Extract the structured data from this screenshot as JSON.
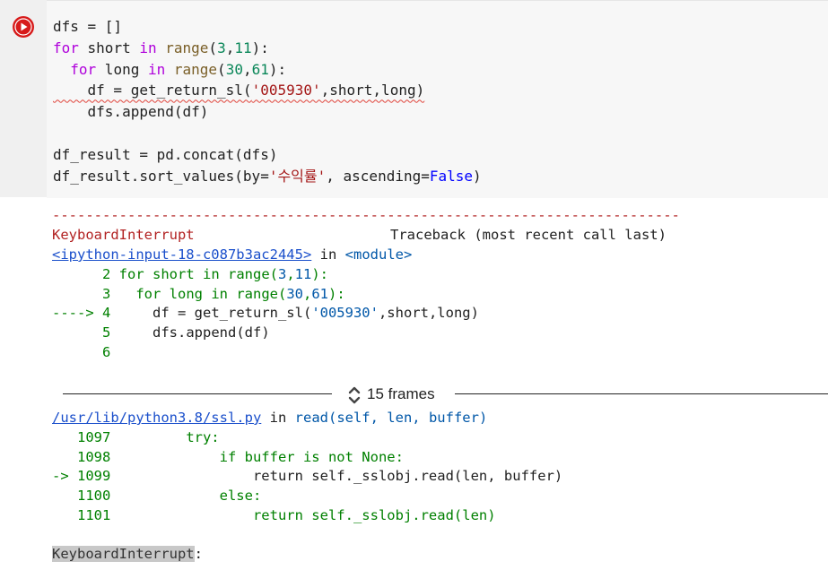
{
  "cell": {
    "code_lines": [
      {
        "parts": [
          {
            "t": "dfs = []",
            "c": ""
          }
        ]
      },
      {
        "parts": [
          {
            "t": "for",
            "c": "kw"
          },
          {
            "t": " short ",
            "c": ""
          },
          {
            "t": "in",
            "c": "kw"
          },
          {
            "t": " ",
            "c": ""
          },
          {
            "t": "range",
            "c": "bi"
          },
          {
            "t": "(",
            "c": ""
          },
          {
            "t": "3",
            "c": "num"
          },
          {
            "t": ",",
            "c": ""
          },
          {
            "t": "11",
            "c": "num"
          },
          {
            "t": "):",
            "c": ""
          }
        ]
      },
      {
        "parts": [
          {
            "t": "  ",
            "c": ""
          },
          {
            "t": "for",
            "c": "kw"
          },
          {
            "t": " long ",
            "c": ""
          },
          {
            "t": "in",
            "c": "kw"
          },
          {
            "t": " ",
            "c": ""
          },
          {
            "t": "range",
            "c": "bi"
          },
          {
            "t": "(",
            "c": ""
          },
          {
            "t": "30",
            "c": "num"
          },
          {
            "t": ",",
            "c": ""
          },
          {
            "t": "61",
            "c": "num"
          },
          {
            "t": "):",
            "c": ""
          }
        ]
      },
      {
        "parts": [
          {
            "t": "    df = get_return_sl(",
            "c": "squig"
          },
          {
            "t": "'005930'",
            "c": "str squig"
          },
          {
            "t": ",short,long)",
            "c": "squig"
          }
        ]
      },
      {
        "parts": [
          {
            "t": "    dfs.append(df)",
            "c": ""
          }
        ]
      },
      {
        "parts": [
          {
            "t": "",
            "c": ""
          }
        ]
      },
      {
        "parts": [
          {
            "t": "df_result = pd.concat(dfs)",
            "c": ""
          }
        ]
      },
      {
        "parts": [
          {
            "t": "df_result.sort_values(by=",
            "c": ""
          },
          {
            "t": "'수익률'",
            "c": "str"
          },
          {
            "t": ", ascending=",
            "c": ""
          },
          {
            "t": "False",
            "c": "kw2"
          },
          {
            "t": ")",
            "c": ""
          }
        ]
      }
    ]
  },
  "output": {
    "separator": "---------------------------------------------------------------------------",
    "error_name": "KeyboardInterrupt",
    "traceback_header": "Traceback (most recent call last)",
    "frame1": {
      "file_link": "<ipython-input-18-c087b3ac2445>",
      "in_word": "in",
      "func": "<module>",
      "lines": [
        {
          "prefix": "      ",
          "num": "2",
          "code": [
            {
              "t": " for short in range(",
              "c": "green"
            },
            {
              "t": "3",
              "c": "blue"
            },
            {
              "t": ",",
              "c": "green"
            },
            {
              "t": "11",
              "c": "blue"
            },
            {
              "t": "):",
              "c": "green"
            }
          ]
        },
        {
          "prefix": "      ",
          "num": "3",
          "code": [
            {
              "t": "   for long in range(",
              "c": "green"
            },
            {
              "t": "30",
              "c": "blue"
            },
            {
              "t": ",",
              "c": "green"
            },
            {
              "t": "61",
              "c": "blue"
            },
            {
              "t": "):",
              "c": "green"
            }
          ]
        },
        {
          "prefix": "----> ",
          "num": "4",
          "code": [
            {
              "t": "     df = get_return_sl(",
              "c": ""
            },
            {
              "t": "'005930'",
              "c": "blue"
            },
            {
              "t": ",short,long)",
              "c": ""
            }
          ]
        },
        {
          "prefix": "      ",
          "num": "5",
          "code": [
            {
              "t": "     dfs.append(df)",
              "c": ""
            }
          ]
        },
        {
          "prefix": "      ",
          "num": "6",
          "code": [
            {
              "t": "",
              "c": ""
            }
          ]
        }
      ]
    },
    "frames_toggle_label": "15 frames",
    "frame2": {
      "file_link": "/usr/lib/python3.8/ssl.py",
      "in_word": "in",
      "func": "read(self, len, buffer)",
      "lines": [
        {
          "prefix": "   ",
          "num": "1097",
          "code": [
            {
              "t": "         try:",
              "c": "green"
            }
          ]
        },
        {
          "prefix": "   ",
          "num": "1098",
          "code": [
            {
              "t": "             if buffer is not None:",
              "c": "green"
            }
          ]
        },
        {
          "prefix": "-> ",
          "num": "1099",
          "code": [
            {
              "t": "                 return self._sslobj.read(len, buffer)",
              "c": ""
            }
          ]
        },
        {
          "prefix": "   ",
          "num": "1100",
          "code": [
            {
              "t": "             else:",
              "c": "green"
            }
          ]
        },
        {
          "prefix": "   ",
          "num": "1101",
          "code": [
            {
              "t": "                 return self._sslobj.read(len)",
              "c": "green"
            }
          ]
        }
      ]
    },
    "final_error": "KeyboardInterrupt",
    "final_colon": ":"
  }
}
